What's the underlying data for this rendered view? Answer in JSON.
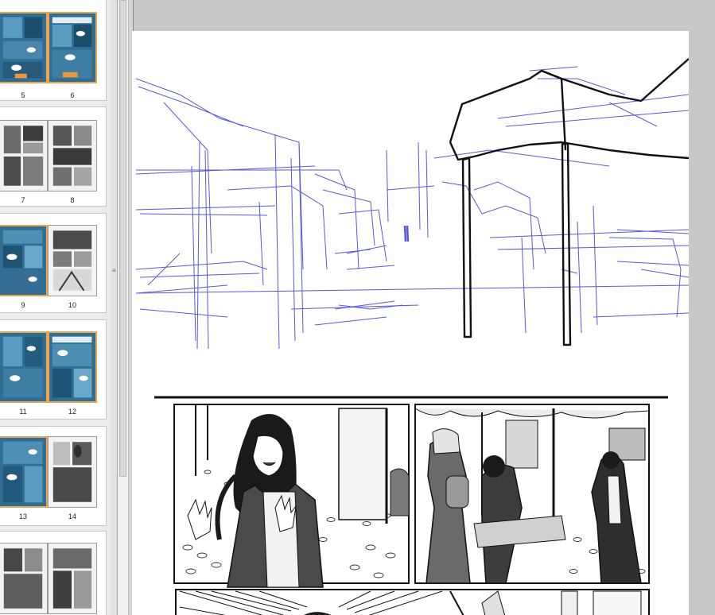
{
  "thumbnails": [
    {
      "left": "5",
      "right": "6"
    },
    {
      "left": "7",
      "right": "8"
    },
    {
      "left": "9",
      "right": "10"
    },
    {
      "left": "11",
      "right": "12"
    },
    {
      "left": "13",
      "right": "14"
    },
    {
      "left": "",
      "right": ""
    }
  ],
  "colors": {
    "sketch_blue": "#3b3bd9",
    "ink": "#111111",
    "thumb_color_border": "#f1a24a",
    "thumb_color_fill": "#2f6f96"
  }
}
